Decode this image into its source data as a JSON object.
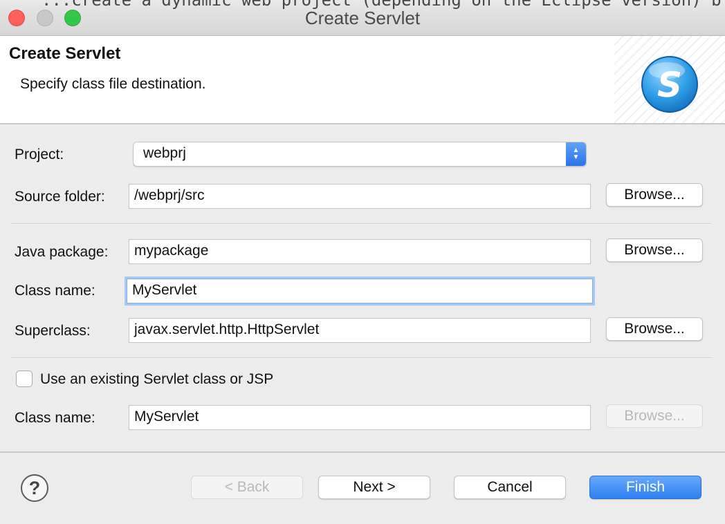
{
  "window": {
    "title": "Create Servlet",
    "background_text": "...create a dynamic web project (depending on the Eclipse version) b"
  },
  "header": {
    "title": "Create Servlet",
    "description": "Specify class file destination.",
    "logo_letter": "S"
  },
  "form": {
    "project_label": "Project:",
    "project_value": "webprj",
    "source_folder_label": "Source folder:",
    "source_folder_value": "/webprj/src",
    "java_package_label": "Java package:",
    "java_package_value": "mypackage",
    "class_name_label": "Class name:",
    "class_name_value": "MyServlet",
    "superclass_label": "Superclass:",
    "superclass_value": "javax.servlet.http.HttpServlet",
    "existing_checkbox_label": "Use an existing Servlet class or JSP",
    "existing_checked": false,
    "existing_class_name_label": "Class name:",
    "existing_class_name_value": "MyServlet",
    "browse_label": "Browse..."
  },
  "footer": {
    "help_label": "?",
    "back_label": "< Back",
    "next_label": "Next >",
    "cancel_label": "Cancel",
    "finish_label": "Finish"
  },
  "colors": {
    "accent": "#2d7ff0",
    "focus_ring": "#a7c8f0",
    "close": "#fc605c",
    "maximize": "#34c84a"
  }
}
